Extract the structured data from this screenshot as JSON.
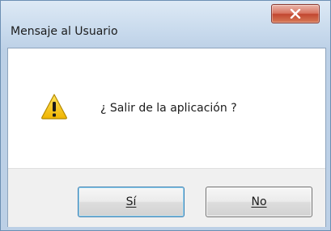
{
  "window": {
    "title": "Mensaje al Usuario",
    "close_icon": "close-icon"
  },
  "message": {
    "icon": "warning-icon",
    "text": "¿ Salir de la aplicación ?"
  },
  "buttons": {
    "yes_label": "Sí",
    "no_label": "No"
  },
  "colors": {
    "titlebar": "#c7d9ec",
    "close_button": "#c14630",
    "warning": "#f5c400"
  }
}
